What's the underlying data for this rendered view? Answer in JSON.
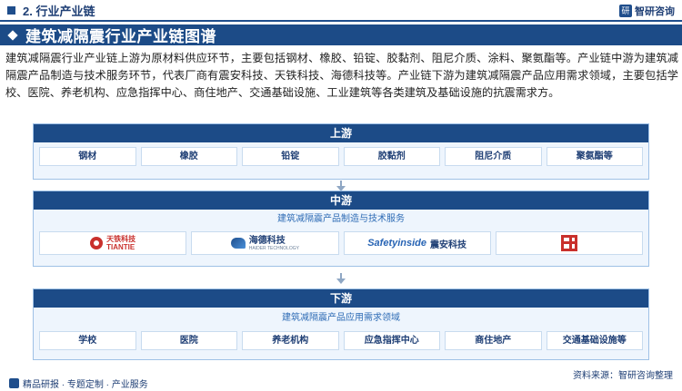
{
  "header": {
    "section": "2. 行业产业链",
    "logo_name": "智研咨询"
  },
  "title": "建筑减隔震行业产业链图谱",
  "intro": "建筑减隔震行业产业链上游为原材料供应环节，主要包括钢材、橡胶、铅锭、胶黏剂、阻尼介质、涂料、聚氨酯等。产业链中游为建筑减隔震产品制造与技术服务环节，代表厂商有震安科技、天铁科技、海德科技等。产业链下游为建筑减隔震产品应用需求领域，主要包括学校、医院、养老机构、应急指挥中心、商住地产、交通基础设施、工业建筑等各类建筑及基础设施的抗震需求方。",
  "upstream": {
    "title": "上游",
    "items": [
      "钢材",
      "橡胶",
      "铅锭",
      "胶黏剂",
      "阻尼介质",
      "聚氨酯等"
    ]
  },
  "midstream": {
    "title": "中游",
    "subtitle": "建筑减隔震产品制造与技术服务",
    "logos": [
      {
        "name": "天铁科技",
        "sub": "TIANTIE"
      },
      {
        "name": "海德科技",
        "sub": "HAIDER TECHNOLOGY"
      },
      {
        "brand": "Safetyinside",
        "name": "震安科技"
      },
      {
        "name": ""
      }
    ]
  },
  "downstream": {
    "title": "下游",
    "subtitle": "建筑减隔震产品应用需求领域",
    "items": [
      "学校",
      "医院",
      "养老机构",
      "应急指挥中心",
      "商住地产",
      "交通基础设施等"
    ]
  },
  "footer": {
    "left": "精品研报 · 专题定制 · 产业服务",
    "source": "资料来源：智研咨询整理"
  },
  "colors": {
    "primary": "#1c4b87",
    "panel_bg": "#eef5fd",
    "accent_red": "#c9302c"
  }
}
